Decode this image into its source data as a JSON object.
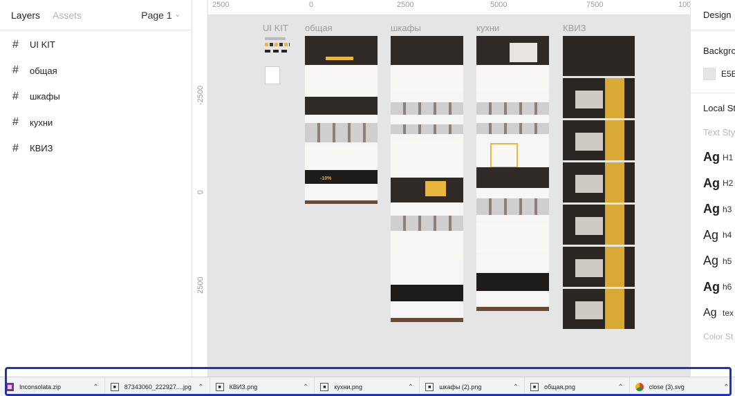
{
  "left": {
    "tab_layers": "Layers",
    "tab_assets": "Assets",
    "page": "Page 1",
    "layers": [
      "UI KIT",
      "общая",
      "шкафы",
      "кухни",
      "КВИЗ"
    ]
  },
  "rulers": {
    "top": [
      "2500",
      "0",
      "2500",
      "5000",
      "7500",
      "100"
    ],
    "left": [
      "-2500",
      "0",
      "2500"
    ]
  },
  "canvas": {
    "frames": [
      "UI KIT",
      "общая",
      "шкафы",
      "кухни",
      "КВИЗ"
    ],
    "percent_badge": "-10%"
  },
  "right": {
    "tab": "Design",
    "background_label": "Backgro",
    "background_value": "E5E",
    "local_styles": "Local St",
    "text_styles": "Text Sty",
    "styles": [
      {
        "sample": "Ag",
        "name": "H1",
        "weight": "bold"
      },
      {
        "sample": "Ag",
        "name": "H2",
        "weight": "bold"
      },
      {
        "sample": "Ag",
        "name": "h3",
        "weight": "bold"
      },
      {
        "sample": "Ag",
        "name": "h4",
        "weight": "normal"
      },
      {
        "sample": "Ag",
        "name": "h5",
        "weight": "normal"
      },
      {
        "sample": "Ag",
        "name": "h6",
        "weight": "bold"
      },
      {
        "sample": "Ag",
        "name": "tex",
        "weight": "normal"
      }
    ],
    "color_styles": "Color St"
  },
  "downloads": [
    {
      "name": "Inconsolata.zip",
      "icon": "zip-icon"
    },
    {
      "name": "87343060_222927....jpg",
      "icon": "image-icon"
    },
    {
      "name": "КВИЗ.png",
      "icon": "image-icon"
    },
    {
      "name": "кухни.png",
      "icon": "image-icon"
    },
    {
      "name": "шкафы (2).png",
      "icon": "image-icon"
    },
    {
      "name": "общая.png",
      "icon": "image-icon"
    },
    {
      "name": "close (3).svg",
      "icon": "chrome-icon"
    }
  ],
  "colors": {
    "accent_gold": "#e9b63e",
    "canvas_bg": "#e5e5e5",
    "highlight": "#1a32c8"
  }
}
